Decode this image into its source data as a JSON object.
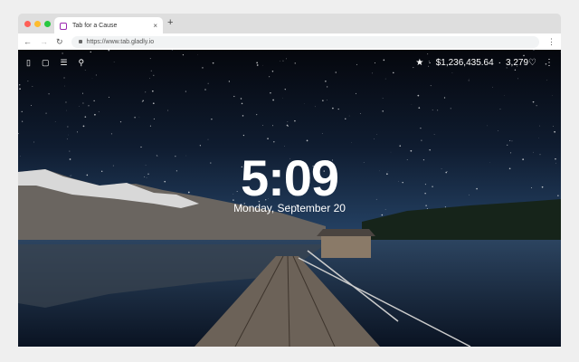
{
  "browser": {
    "tab_title": "Tab for a Cause",
    "url": "https://www.tab.gladly.io",
    "new_tab": "+",
    "close": "×"
  },
  "toolbar": {
    "back": "←",
    "forward": "→",
    "reload": "↻",
    "menu": "⋮"
  },
  "left_icons": [
    "bookmark-icon",
    "chat-icon",
    "list-icon",
    "search-icon"
  ],
  "stats": {
    "star": "★",
    "sep": "·",
    "money": "$1,236,435.64",
    "hearts": "3,279",
    "heart": "♡",
    "menu": "⋮"
  },
  "clock": {
    "time": "5:09",
    "date": "Monday, September 20"
  }
}
